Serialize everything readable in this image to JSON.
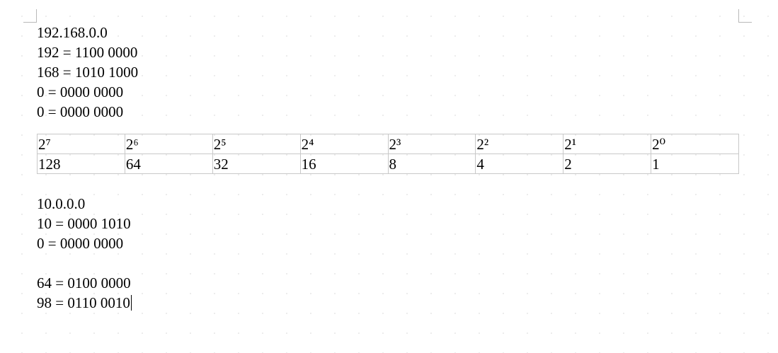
{
  "section1": {
    "lines": [
      "192.168.0.0",
      "192 = 1100 0000",
      "168 = 1010 1000",
      "0 = 0000 0000",
      "0 = 0000 0000"
    ]
  },
  "powers_table": {
    "header": [
      "2⁷",
      "2⁶",
      "2⁵",
      "2⁴",
      "2³",
      "2²",
      "2¹",
      "2⁰"
    ],
    "values": [
      "128",
      "64",
      "32",
      "16",
      "8",
      "4",
      "2",
      "1"
    ]
  },
  "section2": {
    "lines": [
      "10.0.0.0",
      "10 = 0000 1010",
      "0 = 0000 0000"
    ]
  },
  "section3": {
    "lines": [
      "64 = 0100 0000",
      "98 = 0110 0010"
    ]
  }
}
